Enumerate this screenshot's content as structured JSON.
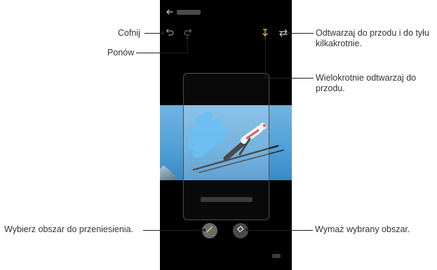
{
  "callouts": {
    "undo": "Cofnij",
    "redo": "Ponów",
    "loop": "Odtwarzaj do przodu i do tyłu kilkakrotnie.",
    "repeat": "Wielokrotnie odtwarzaj do przodu.",
    "select_area": "Wybierz obszar do przeniesienia.",
    "erase_area": "Wymaż wybrany obszar."
  },
  "icons": {
    "back": "back-arrow-icon",
    "undo": "undo-icon",
    "redo": "redo-icon",
    "repeat": "repeat-forward-icon",
    "loop": "loop-icon",
    "brush": "brush-icon",
    "eraser": "eraser-icon"
  },
  "colors": {
    "screen_background": "#000000",
    "sky": "#4f9fd6",
    "brush_accent": "#e8c14a",
    "callout_text": "#333333"
  }
}
